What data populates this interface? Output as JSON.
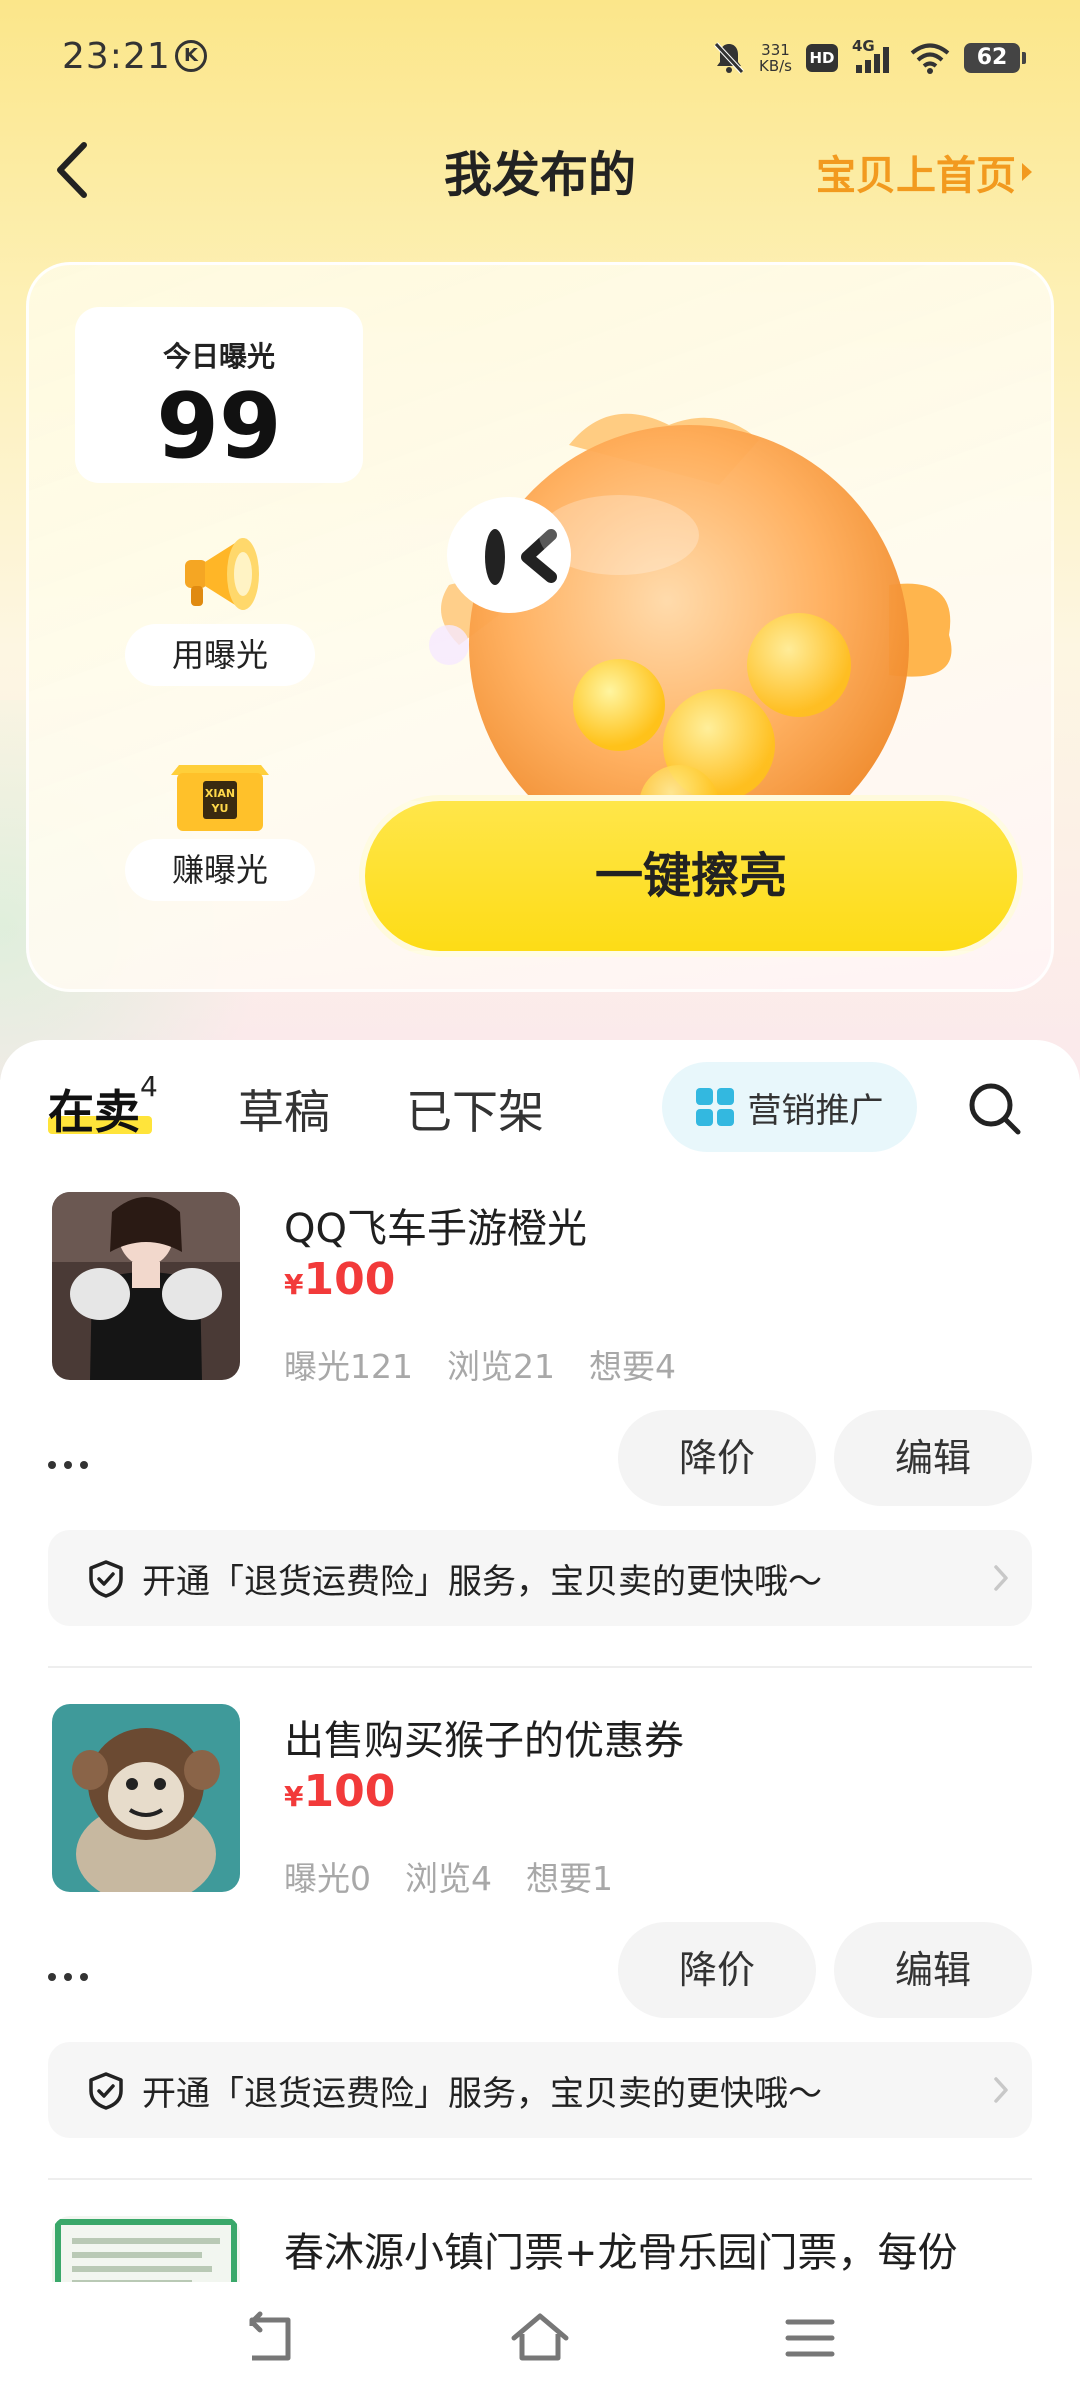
{
  "status": {
    "time": "23:21",
    "k_icon": "K",
    "net_speed_value": "331",
    "net_speed_unit": "KB/s",
    "hd": "HD",
    "network": "4G",
    "battery": "62"
  },
  "header": {
    "title": "我发布的",
    "promo_link": "宝贝上首页"
  },
  "card": {
    "today_label": "今日曝光",
    "today_value": "99",
    "use_exposure": "用曝光",
    "earn_exposure": "赚曝光",
    "box_brand_line1": "XIAN",
    "box_brand_line2": "YU",
    "shine_button": "一键擦亮"
  },
  "tabs": {
    "selling": "在卖",
    "selling_count": "4",
    "drafts": "草稿",
    "offline": "已下架",
    "marketing": "营销推广"
  },
  "items": [
    {
      "title": "QQ飞车手游橙光",
      "currency": "¥",
      "price": "100",
      "stat_exposure": "曝光121",
      "stat_views": "浏览21",
      "stat_wants": "想要4",
      "reduce_price": "降价",
      "edit": "编辑",
      "insurance": "开通「退货运费险」服务，宝贝卖的更快哦～"
    },
    {
      "title": "出售购买猴子的优惠券",
      "currency": "¥",
      "price": "100",
      "stat_exposure": "曝光0",
      "stat_views": "浏览4",
      "stat_wants": "想要1",
      "reduce_price": "降价",
      "edit": "编辑",
      "insurance": "开通「退货运费险」服务，宝贝卖的更快哦～"
    },
    {
      "title": "春沐源小镇门票+龙骨乐园门票，每份"
    }
  ],
  "icons": {
    "back": "back-arrow-icon",
    "promo_arrow": "triangle-right-icon",
    "megaphone": "megaphone-icon",
    "box": "gift-box-icon",
    "mascot": "pufferfish-mascot-icon",
    "marketing": "grid-apps-icon",
    "search": "search-icon",
    "shield": "shield-check-icon",
    "more": "more-dots-icon",
    "nav_back": "nav-back-icon",
    "nav_home": "nav-home-icon",
    "nav_menu": "nav-menu-icon"
  },
  "colors": {
    "accent_yellow": "#fddc16",
    "price_red": "#f23a3a",
    "promo_orange": "#f29a1f",
    "marketing_blue": "#33b8e0"
  }
}
